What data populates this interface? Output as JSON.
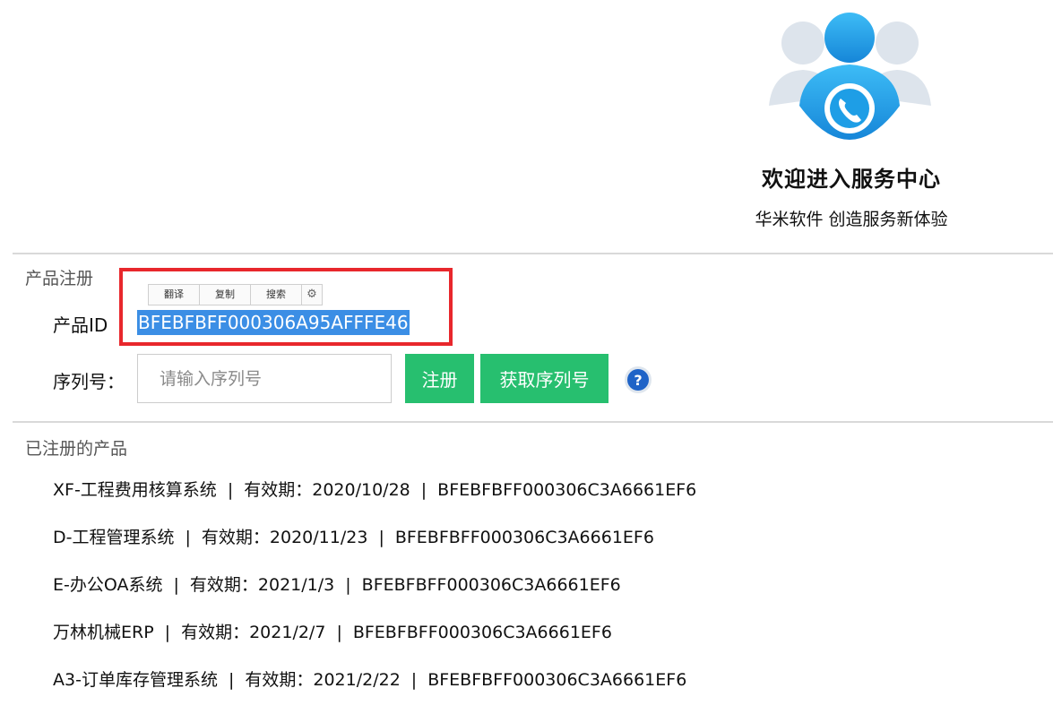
{
  "header": {
    "title": "欢迎进入服务中心",
    "subtitle": "华米软件  创造服务新体验",
    "logo_icon": "service-center-logo-icon"
  },
  "registration": {
    "section_title": "产品注册",
    "product_id_label": "产品ID",
    "product_id_value": "BFEBFBFF000306A95AFFFE46",
    "toolbar": {
      "translate": "翻译",
      "copy": "复制",
      "search": "搜索",
      "settings_icon": "gear-icon"
    },
    "serial_label": "序列号：",
    "serial_placeholder": "请输入序列号",
    "serial_value": "",
    "register_button": "注册",
    "get_serial_button": "获取序列号",
    "help_icon": "question-mark-icon"
  },
  "registered": {
    "section_title": "已注册的产品",
    "validity_label": "有效期：",
    "separator": "|",
    "items": [
      {
        "name": "XF-工程费用核算系统",
        "expiry": "2020/10/28",
        "code": "BFEBFBFF000306C3A6661EF6"
      },
      {
        "name": "D-工程管理系统",
        "expiry": "2020/11/23",
        "code": "BFEBFBFF000306C3A6661EF6"
      },
      {
        "name": "E-办公OA系统",
        "expiry": "2021/1/3",
        "code": "BFEBFBFF000306C3A6661EF6"
      },
      {
        "name": "万林机械ERP",
        "expiry": "2021/2/7",
        "code": "BFEBFBFF000306C3A6661EF6"
      },
      {
        "name": "A3-订单库存管理系统",
        "expiry": "2021/2/22",
        "code": "BFEBFBFF000306C3A6661EF6"
      }
    ]
  },
  "colors": {
    "accent_green": "#27bf6f",
    "highlight_blue": "#3b8ee5",
    "annotation_red": "#e8272c",
    "logo_blue": "#1e9ee6"
  }
}
